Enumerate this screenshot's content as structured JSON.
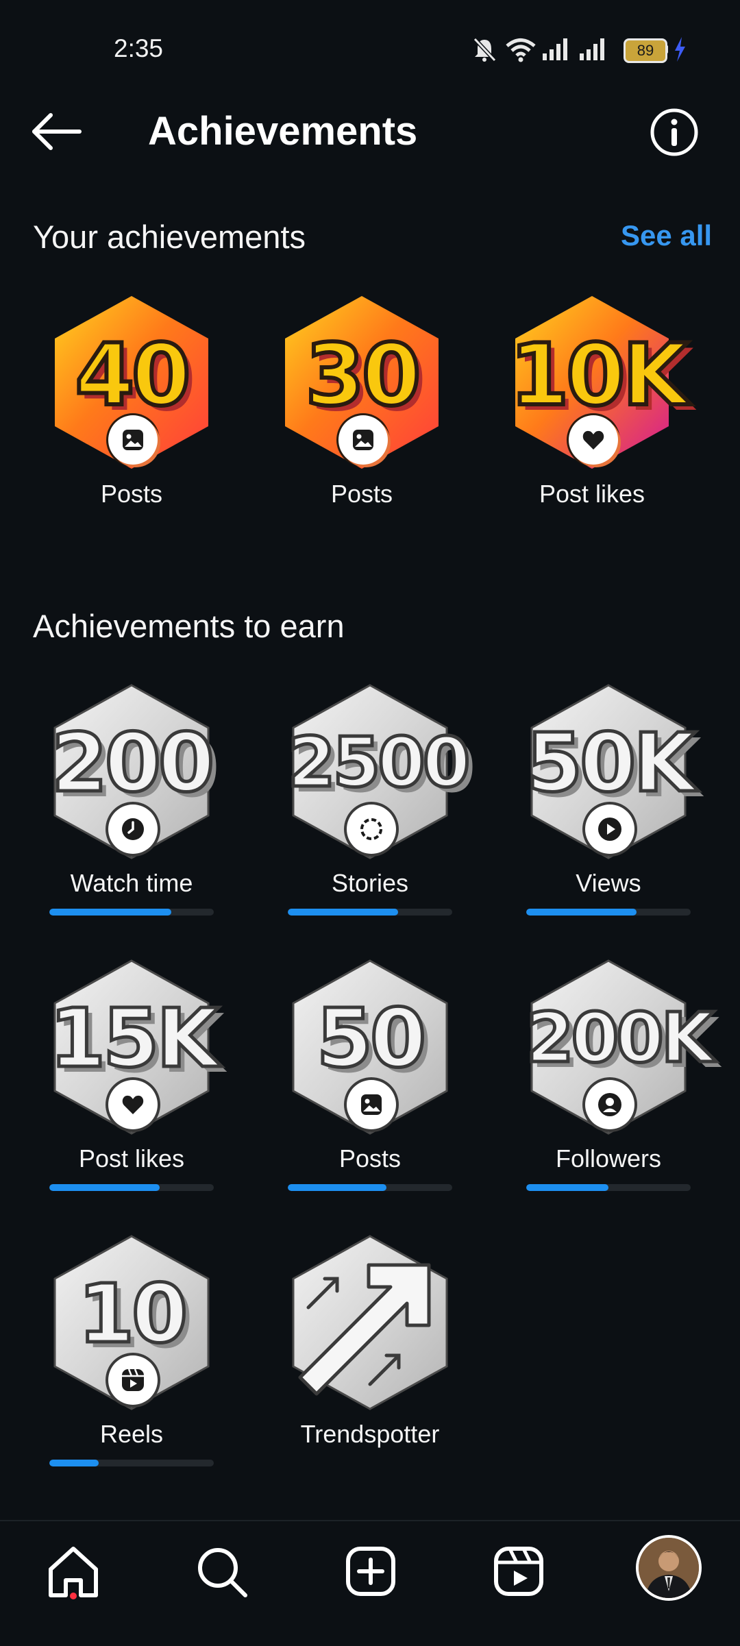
{
  "status_bar": {
    "time": "2:35",
    "battery": "89"
  },
  "header": {
    "title": "Achievements"
  },
  "your_achievements": {
    "title": "Your achievements",
    "see_all": "See all",
    "items": [
      {
        "value": "40",
        "label": "Posts",
        "icon": "image-icon"
      },
      {
        "value": "30",
        "label": "Posts",
        "icon": "image-icon"
      },
      {
        "value": "10K",
        "label": "Post likes",
        "icon": "heart-icon"
      }
    ]
  },
  "to_earn": {
    "title": "Achievements to earn",
    "items": [
      {
        "value": "200",
        "label": "Watch time",
        "icon": "clock-icon",
        "progress": 0.74
      },
      {
        "value": "2500",
        "label": "Stories",
        "icon": "story-ring-icon",
        "progress": 0.67
      },
      {
        "value": "50K",
        "label": "Views",
        "icon": "play-icon",
        "progress": 0.67
      },
      {
        "value": "15K",
        "label": "Post likes",
        "icon": "heart-icon",
        "progress": 0.67
      },
      {
        "value": "50",
        "label": "Posts",
        "icon": "image-icon",
        "progress": 0.6
      },
      {
        "value": "200K",
        "label": "Followers",
        "icon": "person-icon",
        "progress": 0.5
      },
      {
        "value": "10",
        "label": "Reels",
        "icon": "reels-icon",
        "progress": 0.3
      },
      {
        "value": "",
        "label": "Trendspotter",
        "icon": "trending-arrow-icon",
        "progress": null
      }
    ]
  },
  "bottom_nav": {
    "items": [
      "home-icon",
      "search-icon",
      "create-icon",
      "reels-icon",
      "profile-avatar"
    ]
  },
  "colors": {
    "background": "#0c1014",
    "accent": "#3797f0",
    "progress": "#1d8ff0"
  }
}
